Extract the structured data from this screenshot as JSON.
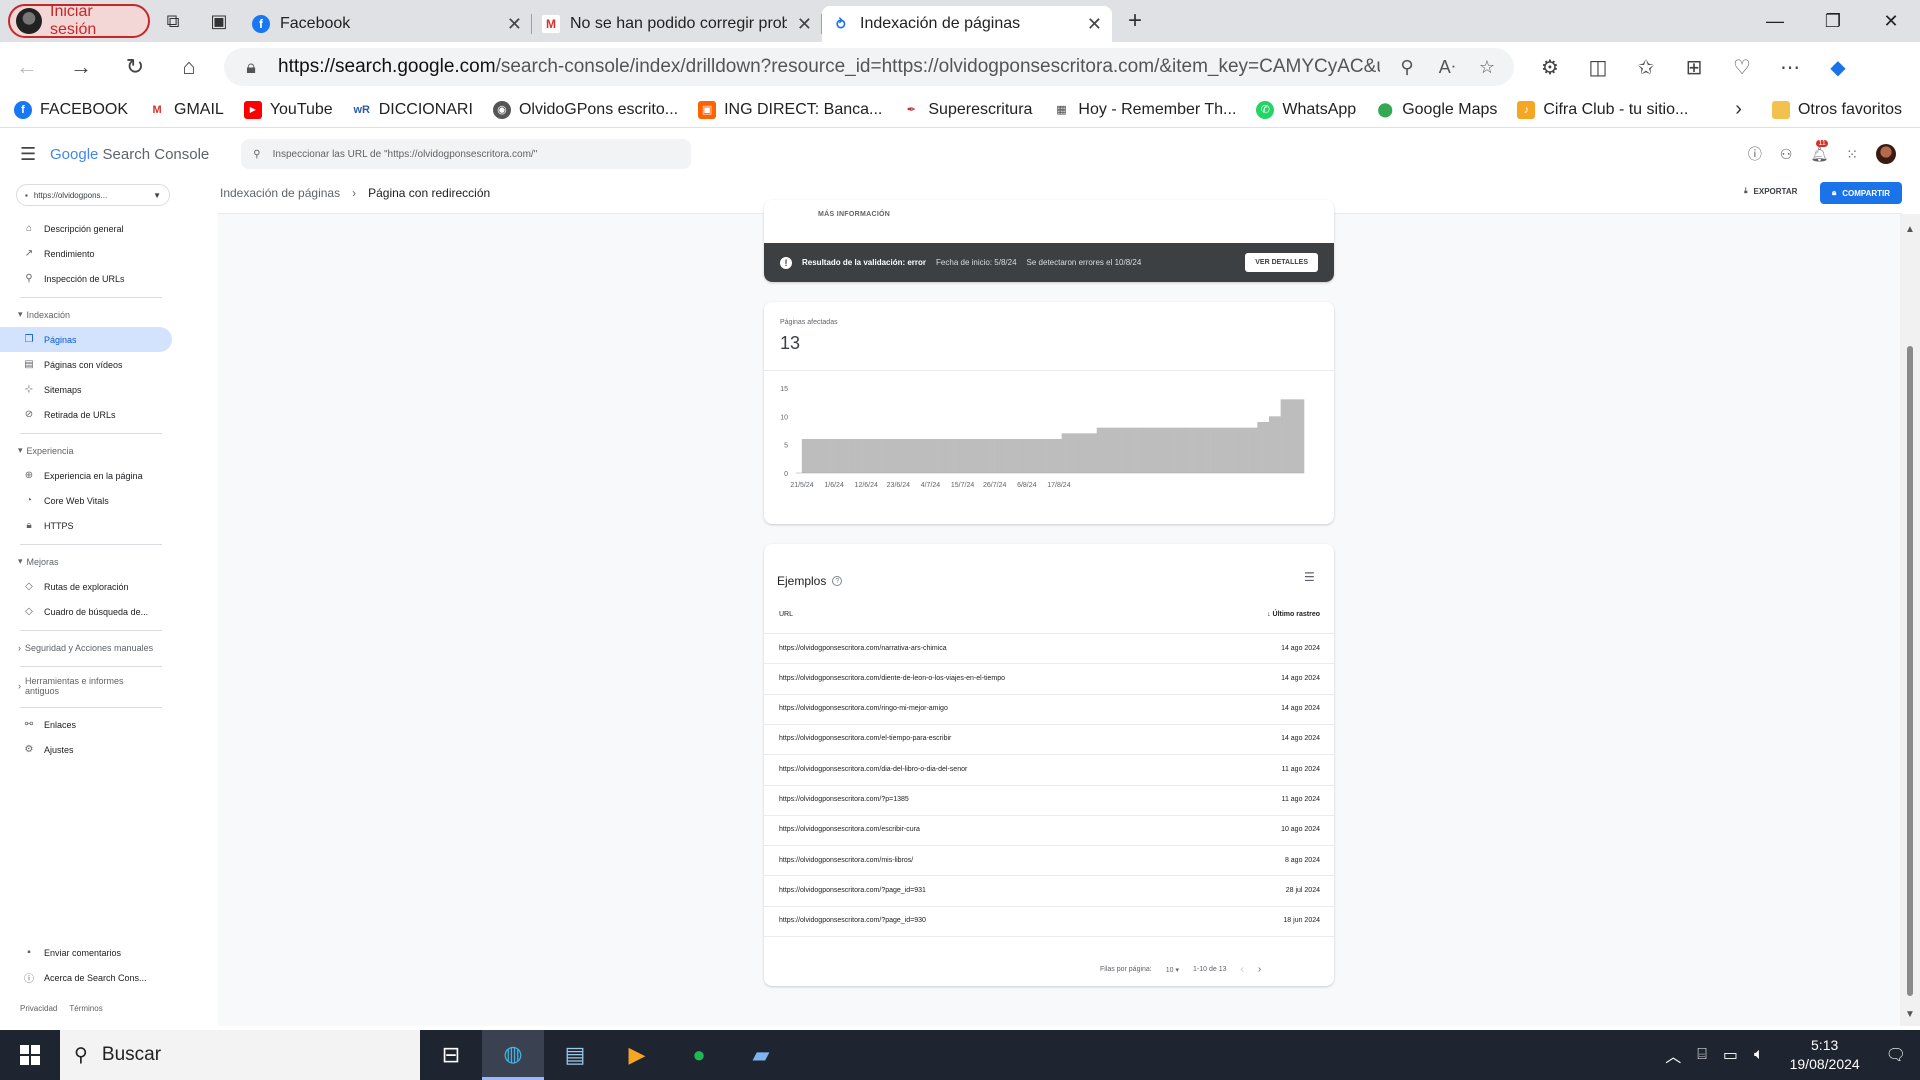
{
  "browser": {
    "profile_label": "Iniciar sesión",
    "tabs": [
      {
        "title": "Facebook"
      },
      {
        "title": "No se han podido corregir proble"
      },
      {
        "title": "Indexación de páginas"
      }
    ],
    "url_domain": "https://search.google.com",
    "url_path": "/search-console/index/drilldown?resource_id=https://olvidogponsescritora.com/&item_key=CAMYCyAC&utm_...",
    "bookmarks": [
      {
        "label": "FACEBOOK"
      },
      {
        "label": "GMAIL"
      },
      {
        "label": "YouTube"
      },
      {
        "label": "DICCIONARI"
      },
      {
        "label": "OlvidoGPons escrito..."
      },
      {
        "label": "ING DIRECT: Banca..."
      },
      {
        "label": "Superescritura"
      },
      {
        "label": "Hoy - Remember Th..."
      },
      {
        "label": "WhatsApp"
      },
      {
        "label": "Google Maps"
      },
      {
        "label": "Cifra Club - tu sitio..."
      }
    ],
    "other_favorites": "Otros favoritos"
  },
  "console": {
    "logo_google": "Google",
    "logo_product": "Search Console",
    "search_placeholder": "Inspeccionar las URL de \"https://olvidogponsescritora.com/\"",
    "notification_count": "11",
    "property": "https://olvidogpons...",
    "nav": {
      "overview": "Descripción general",
      "performance": "Rendimiento",
      "url_inspection": "Inspección de URLs",
      "sec_indexing": "Indexación",
      "pages": "Páginas",
      "video_pages": "Páginas con vídeos",
      "sitemaps": "Sitemaps",
      "removals": "Retirada de URLs",
      "sec_experience": "Experiencia",
      "page_experience": "Experiencia en la página",
      "cwv": "Core Web Vitals",
      "https": "HTTPS",
      "sec_enhancements": "Mejoras",
      "breadcrumbs": "Rutas de exploración",
      "sitelinks": "Cuadro de búsqueda de...",
      "sec_security": "Seguridad y Acciones manuales",
      "sec_legacy": "Herramientas e informes antiguos",
      "links": "Enlaces",
      "settings": "Ajustes",
      "feedback": "Enviar comentarios",
      "about": "Acerca de Search Cons...",
      "privacy": "Privacidad",
      "terms": "Términos"
    },
    "breadcrumb_parent": "Indexación de páginas",
    "breadcrumb_current": "Página con redirección",
    "export_label": "EXPORTAR",
    "share_label": "COMPARTIR",
    "more_info": "MÁS INFORMACIÓN",
    "validation": {
      "title": "Resultado de la validación: error",
      "start": "Fecha de inicio: 5/8/24",
      "errors": "Se detectaron errores el 10/8/24",
      "button": "VER DETALLES"
    },
    "affected_label": "Páginas afectadas",
    "affected_count": "13",
    "examples_title": "Ejemplos",
    "col_url": "URL",
    "col_date": "Último rastreo",
    "rows": [
      {
        "url": "https://olvidogponsescritora.com/narrativa-ars-chimica",
        "date": "14 ago 2024"
      },
      {
        "url": "https://olvidogponsescritora.com/diente-de-leon-o-los-viajes-en-el-tiempo",
        "date": "14 ago 2024"
      },
      {
        "url": "https://olvidogponsescritora.com/ringo-mi-mejor-amigo",
        "date": "14 ago 2024"
      },
      {
        "url": "https://olvidogponsescritora.com/el-tiempo-para-escribir",
        "date": "14 ago 2024"
      },
      {
        "url": "https://olvidogponsescritora.com/dia-del-libro-o-dia-del-senor",
        "date": "11 ago 2024"
      },
      {
        "url": "https://olvidogponsescritora.com/?p=1385",
        "date": "11 ago 2024"
      },
      {
        "url": "https://olvidogponsescritora.com/escribir-cura",
        "date": "10 ago 2024"
      },
      {
        "url": "https://olvidogponsescritora.com/mis-libros/",
        "date": "8 ago 2024"
      },
      {
        "url": "https://olvidogponsescritora.com/?page_id=931",
        "date": "28 jul 2024"
      },
      {
        "url": "https://olvidogponsescritora.com/?page_id=930",
        "date": "18 jun 2024"
      }
    ],
    "pager": {
      "rows_label": "Filas por página:",
      "rows_value": "10",
      "range": "1-10 de 13"
    }
  },
  "taskbar": {
    "search_label": "Buscar",
    "time": "5:13",
    "date": "19/08/2024"
  },
  "chart_data": {
    "type": "bar",
    "x_ticks": [
      "21/5/24",
      "1/6/24",
      "12/6/24",
      "23/6/24",
      "4/7/24",
      "15/7/24",
      "26/7/24",
      "6/8/24",
      "17/8/24"
    ],
    "y_ticks": [
      0,
      5,
      10,
      15
    ],
    "ylim": [
      0,
      15
    ],
    "color": "#bdbdbd",
    "start_date": "2024-05-21",
    "values": [
      0,
      0,
      6,
      6,
      6,
      6,
      6,
      6,
      6,
      6,
      6,
      6,
      6,
      6,
      6,
      6,
      6,
      6,
      6,
      6,
      6,
      6,
      6,
      6,
      6,
      6,
      6,
      6,
      6,
      6,
      6,
      6,
      6,
      6,
      6,
      6,
      6,
      6,
      6,
      6,
      6,
      6,
      6,
      6,
      6,
      6,
      6,
      6,
      6,
      6,
      6,
      6,
      6,
      6,
      6,
      6,
      6,
      6,
      6,
      6,
      6,
      6,
      6,
      6,
      6,
      6,
      6,
      6,
      6,
      6,
      6,
      6,
      6,
      6,
      6,
      6,
      6,
      6,
      6,
      6,
      6,
      6,
      6,
      6,
      6,
      6,
      6,
      6,
      6,
      6,
      6,
      7,
      7,
      7,
      7,
      7,
      7,
      7,
      7,
      7,
      7,
      7,
      7,
      8,
      8,
      8,
      8,
      8,
      8,
      8,
      8,
      8,
      8,
      8,
      8,
      8,
      8,
      8,
      8,
      8,
      8,
      8,
      8,
      8,
      8,
      8,
      8,
      8,
      8,
      8,
      8,
      8,
      8,
      8,
      8,
      8,
      8,
      8,
      8,
      8,
      8,
      8,
      8,
      8,
      8,
      8,
      8,
      8,
      8,
      8,
      8,
      8,
      8,
      8,
      8,
      8,
      8,
      8,
      9,
      9,
      9,
      9,
      10,
      10,
      10,
      10,
      13,
      13,
      13,
      13,
      13,
      13,
      13,
      13
    ]
  }
}
